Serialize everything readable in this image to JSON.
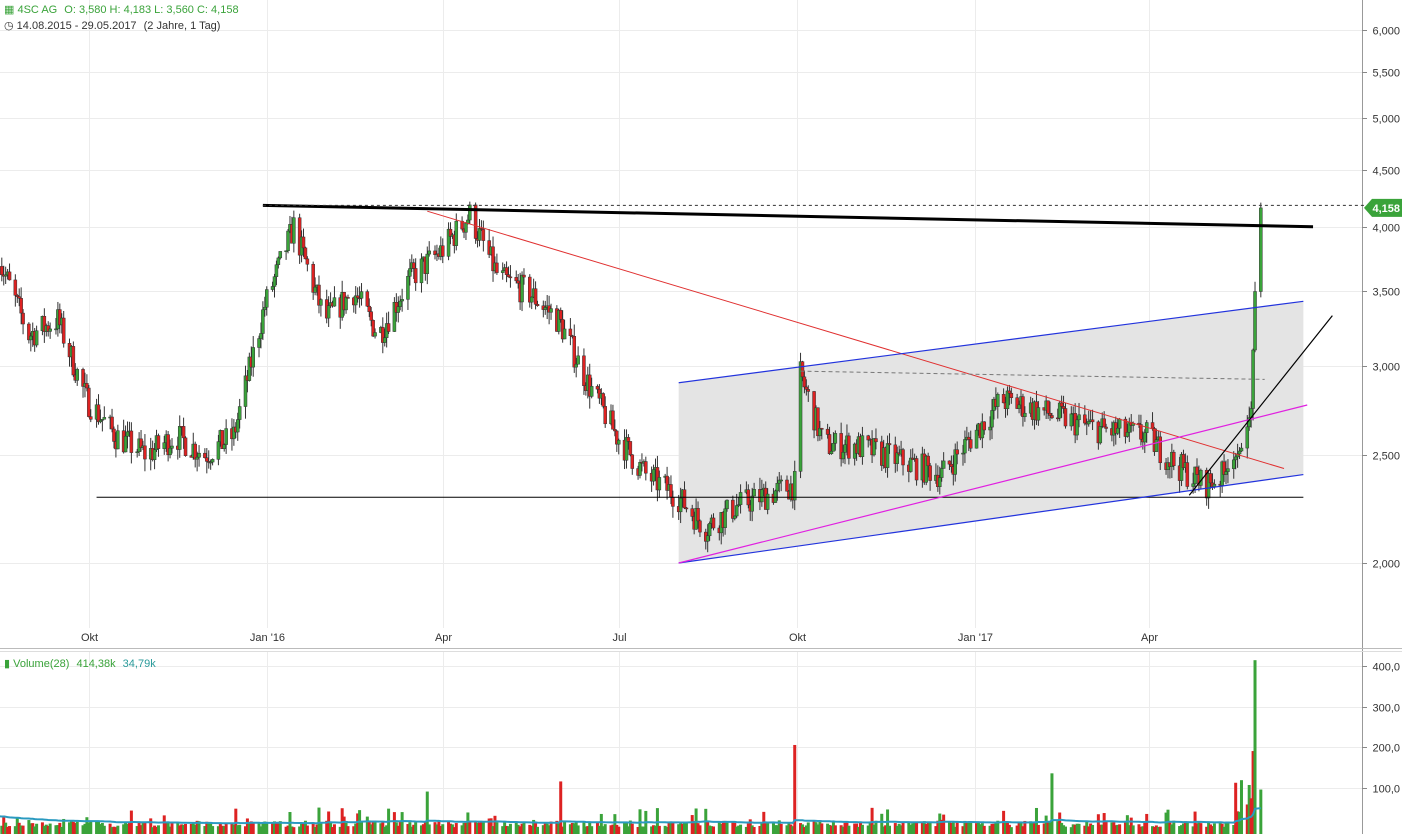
{
  "header": {
    "symbol": "4SC AG",
    "ohlc": "O: 3,580  H: 4,183  L: 3,560  C: 4,158",
    "range": "14.08.2015 - 29.05.2017",
    "period": "(2 Jahre, 1 Tag)",
    "volume_label": "Volume(28)",
    "volume_value": "414,38k",
    "volume_ma": "34,79k"
  },
  "colors": {
    "up": "#3aa33a",
    "down": "#dd2222",
    "trend_black": "#000000",
    "trend_red": "#e03030",
    "channel_blue": "#2233dd",
    "trend_magenta": "#e020e0",
    "channel_fill": "#e4e4e4",
    "price_tag": "#3aa33a",
    "volume_ma_line": "#2a9ac0"
  },
  "chart_data": [
    {
      "type": "candlestick",
      "title": "4SC AG",
      "yscale": "log",
      "ylim": [
        1.8,
        6.2
      ],
      "yticks": [
        "6,000",
        "5,500",
        "5,000",
        "4,500",
        "4,000",
        "3,500",
        "3,000",
        "2,500",
        "2,000"
      ],
      "xtick_labels": [
        "Okt",
        "Jan '16",
        "Apr",
        "Jul",
        "Okt",
        "Jan '17",
        "Apr"
      ],
      "last_price_label": "4,158",
      "series": [
        {
          "name": "close (approx.)",
          "x": [
            "2015-08-14",
            "2015-08-31",
            "2015-09-15",
            "2015-09-30",
            "2015-10-15",
            "2015-10-31",
            "2015-11-15",
            "2015-11-30",
            "2015-12-15",
            "2015-12-31",
            "2016-01-15",
            "2016-01-31",
            "2016-02-15",
            "2016-02-28",
            "2016-03-15",
            "2016-03-31",
            "2016-04-15",
            "2016-04-30",
            "2016-05-15",
            "2016-05-31",
            "2016-06-15",
            "2016-06-30",
            "2016-07-15",
            "2016-07-31",
            "2016-08-15",
            "2016-08-31",
            "2016-09-15",
            "2016-09-30",
            "2016-10-03",
            "2016-10-15",
            "2016-10-31",
            "2016-11-15",
            "2016-11-30",
            "2016-12-15",
            "2016-12-31",
            "2017-01-15",
            "2017-01-31",
            "2017-02-15",
            "2017-02-28",
            "2017-03-15",
            "2017-03-31",
            "2017-04-15",
            "2017-04-30",
            "2017-05-10",
            "2017-05-20",
            "2017-05-24",
            "2017-05-26",
            "2017-05-29"
          ],
          "values": [
            3.8,
            3.2,
            3.3,
            2.8,
            2.6,
            2.5,
            2.6,
            2.5,
            2.6,
            3.4,
            4.0,
            3.3,
            3.5,
            3.2,
            3.6,
            3.8,
            4.1,
            3.6,
            3.5,
            3.3,
            2.9,
            2.6,
            2.4,
            2.3,
            2.15,
            2.25,
            2.3,
            2.35,
            2.95,
            2.55,
            2.55,
            2.5,
            2.45,
            2.4,
            2.6,
            2.8,
            2.75,
            2.7,
            2.65,
            2.62,
            2.6,
            2.45,
            2.35,
            2.4,
            2.55,
            2.75,
            3.5,
            4.158
          ]
        }
      ]
    },
    {
      "type": "bar",
      "title": "Volume(28)",
      "yticks": [
        "400,0",
        "300,0",
        "200,0",
        "100,0"
      ],
      "ylim": [
        0,
        420
      ],
      "series": [
        {
          "name": "volume spikes (approx., k)",
          "x": [
            "2016-03-24",
            "2016-06-01",
            "2016-09-30",
            "2017-02-10",
            "2017-05-25",
            "2017-05-26"
          ],
          "values": [
            90,
            115,
            205,
            135,
            190,
            414.38
          ]
        }
      ]
    }
  ]
}
